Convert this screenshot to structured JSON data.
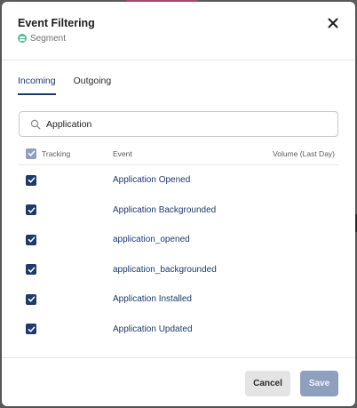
{
  "modal": {
    "title": "Event Filtering",
    "source_name": "Segment",
    "source_icon": "segment-icon",
    "close_icon": "close-icon"
  },
  "tabs": [
    {
      "label": "Incoming",
      "active": true
    },
    {
      "label": "Outgoing",
      "active": false
    }
  ],
  "search": {
    "value": "Application",
    "placeholder": "",
    "icon": "search-icon"
  },
  "table": {
    "headers": {
      "tracking": "Tracking",
      "event": "Event",
      "volume": "Volume (Last Day)"
    },
    "all_checked": true,
    "rows": [
      {
        "checked": true,
        "event": "Application Opened",
        "volume": ""
      },
      {
        "checked": true,
        "event": "Application Backgrounded",
        "volume": ""
      },
      {
        "checked": true,
        "event": "application_opened",
        "volume": ""
      },
      {
        "checked": true,
        "event": "application_backgrounded",
        "volume": ""
      },
      {
        "checked": true,
        "event": "Application Installed",
        "volume": ""
      },
      {
        "checked": true,
        "event": "Application Updated",
        "volume": ""
      }
    ]
  },
  "footer": {
    "cancel_label": "Cancel",
    "save_label": "Save",
    "save_disabled": true
  },
  "colors": {
    "accent": "#1e3a6b",
    "disabled": "#8ea0bd",
    "segment": "#52bd94"
  }
}
